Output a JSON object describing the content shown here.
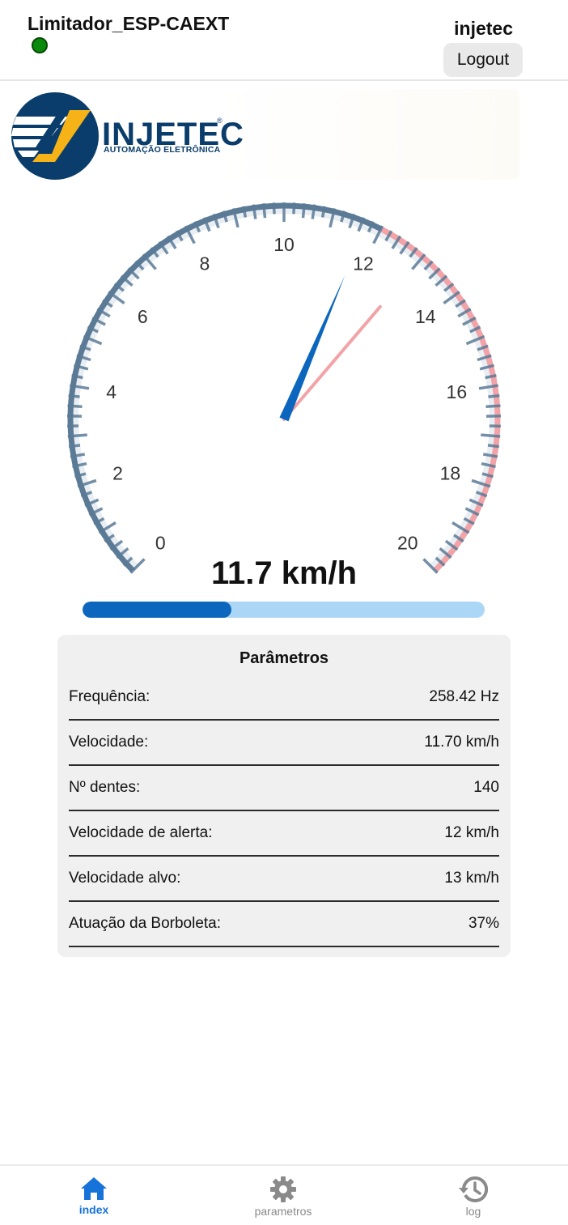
{
  "header": {
    "device_name": "Limitador_ESP-CAEXT",
    "status": "online",
    "status_color": "#0a8a0a",
    "username": "injetec",
    "logout_label": "Logout"
  },
  "logo": {
    "brand": "INJETEC",
    "registered": "®",
    "subtitle": "AUTOMAÇÃO ELETRÔNICA",
    "colors": {
      "navy": "#0a3d6b",
      "yellow": "#f5b318"
    }
  },
  "gauge": {
    "min": 0,
    "max": 20,
    "major_labels": [
      "0",
      "2",
      "4",
      "6",
      "8",
      "10",
      "12",
      "14",
      "16",
      "18",
      "20"
    ],
    "alert_from": 12,
    "value": 11.7,
    "secondary_needle_value": 13.0,
    "normal_color": "#5a7a96",
    "alert_color": "#f2a3a8",
    "needle_color": "#0c66bd",
    "secondary_needle_color": "#f2a3a8"
  },
  "speed_readout": "11.7 km/h",
  "progress": {
    "percent": 37
  },
  "params": {
    "title": "Parâmetros",
    "rows": [
      {
        "label": "Frequência:",
        "value": "258.42 Hz"
      },
      {
        "label": "Velocidade:",
        "value": "11.70 km/h"
      },
      {
        "label": "Nº dentes:",
        "value": "140"
      },
      {
        "label": "Velocidade de alerta:",
        "value": "12 km/h"
      },
      {
        "label": "Velocidade alvo:",
        "value": "13 km/h"
      },
      {
        "label": "Atuação da Borboleta:",
        "value": "37%"
      }
    ]
  },
  "nav": {
    "items": [
      {
        "label": "index",
        "icon": "home-icon",
        "active": true
      },
      {
        "label": "parametros",
        "icon": "gear-icon",
        "active": false
      },
      {
        "label": "log",
        "icon": "history-icon",
        "active": false
      }
    ]
  }
}
